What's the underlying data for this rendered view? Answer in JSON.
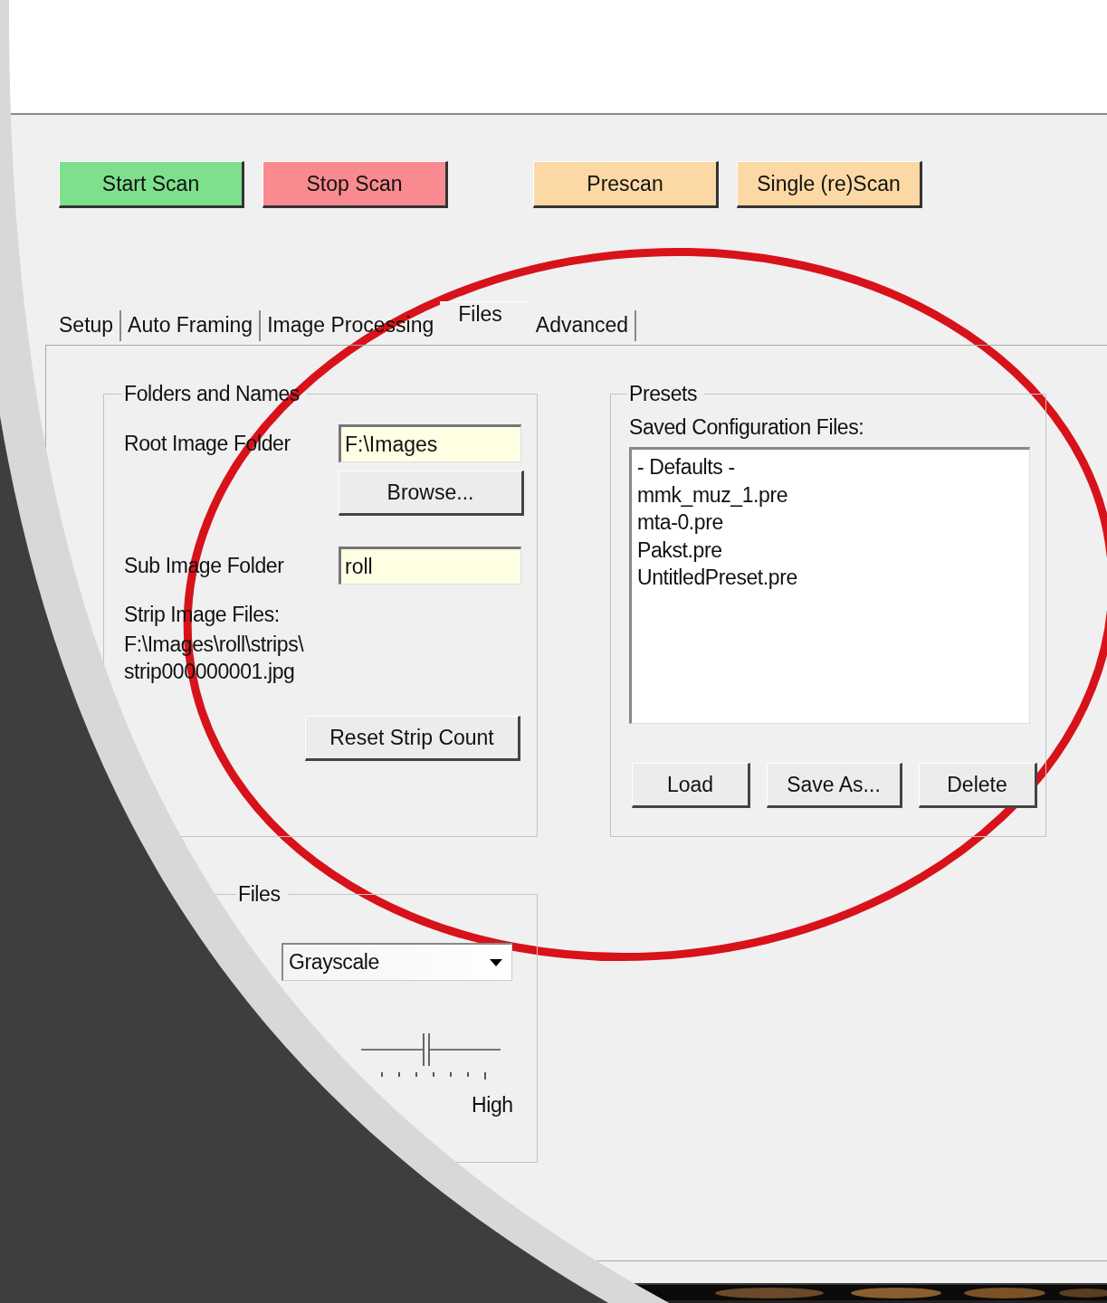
{
  "scan_buttons": [
    {
      "label": "Start Scan",
      "color": "#7ee08c"
    },
    {
      "label": "Stop Scan",
      "color": "#f98b90"
    },
    {
      "label": "Prescan",
      "color": "#fcd8a4"
    },
    {
      "label": "Single (re)Scan",
      "color": "#fcd8a4"
    }
  ],
  "tabs": [
    {
      "label": "Setup",
      "selected": false
    },
    {
      "label": "Auto Framing",
      "selected": false
    },
    {
      "label": "Image Processing",
      "selected": false
    },
    {
      "label": "Files",
      "selected": true
    },
    {
      "label": "Advanced",
      "selected": false
    }
  ],
  "folders_group": {
    "title": "Folders and Names",
    "root_label": "Root Image Folder",
    "root_value": "F:\\Images",
    "browse_button": "Browse...",
    "sub_label": "Sub Image Folder",
    "sub_value": "roll",
    "strip_label": "Strip Image Files:",
    "strip_path": [
      "F:\\Images\\roll\\strips\\",
      "strip000000001.jpg"
    ],
    "reset_button": "Reset Strip Count"
  },
  "presets_group": {
    "title": "Presets",
    "list_label": "Saved Configuration Files:",
    "files": [
      "- Defaults -",
      "mmk_muz_1.pre",
      "mta-0.pre",
      "Pakst.pre",
      "UntitledPreset.pre"
    ],
    "buttons": [
      "Load",
      "Save As...",
      "Delete"
    ]
  },
  "output_group": {
    "title": "Files",
    "format_value": "Grayscale",
    "quality": {
      "level": 0.47,
      "high_label": "High"
    }
  }
}
